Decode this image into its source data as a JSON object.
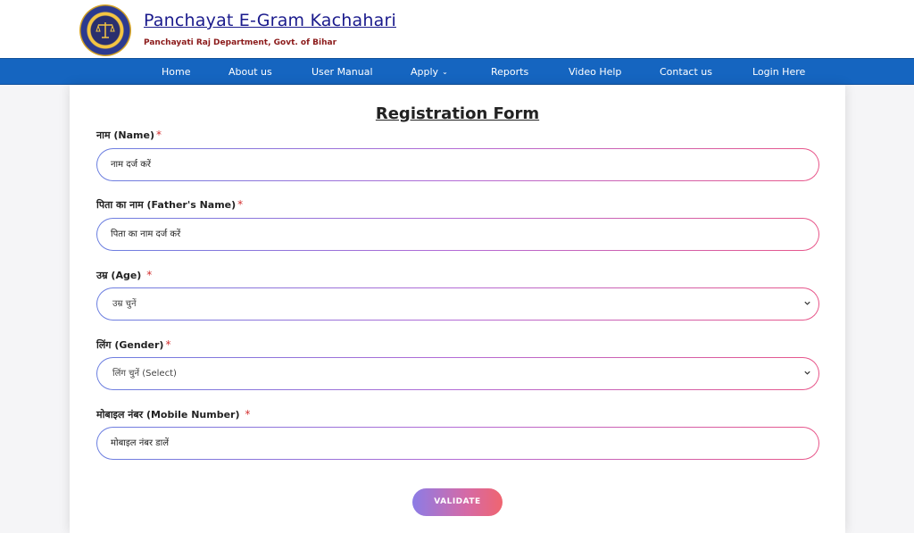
{
  "header": {
    "title": "Panchayat E-Gram Kachahari",
    "subtitle": "Panchayati Raj Department, Govt. of Bihar"
  },
  "nav": {
    "home": "Home",
    "about": "About us",
    "manual": "User Manual",
    "apply": "Apply",
    "reports": "Reports",
    "video": "Video Help",
    "contact": "Contact us",
    "login": "Login Here"
  },
  "form": {
    "title": "Registration Form",
    "name_label": "नाम (Name)",
    "name_placeholder": "नाम दर्ज करें",
    "father_label": "पिता का नाम (Father's Name)",
    "father_placeholder": "पिता का नाम दर्ज करें",
    "age_label": "उम्र (Age)",
    "age_selected": "उम्र चुनें",
    "gender_label": "लिंग (Gender)",
    "gender_selected": "लिंग चुनें (Select)",
    "mobile_label": "मोबाइल नंबर (Mobile Number)",
    "mobile_placeholder": "मोबाइल नंबर डालें",
    "required_mark": "*",
    "validate_label": "VALIDATE"
  },
  "colors": {
    "nav_bg": "#1565c0",
    "title_blue": "#1a1a8c",
    "subtitle_red": "#8b1a1a",
    "required_red": "#d32f2f"
  },
  "icons": [
    "emblem-logo",
    "chevron-down-icon"
  ]
}
